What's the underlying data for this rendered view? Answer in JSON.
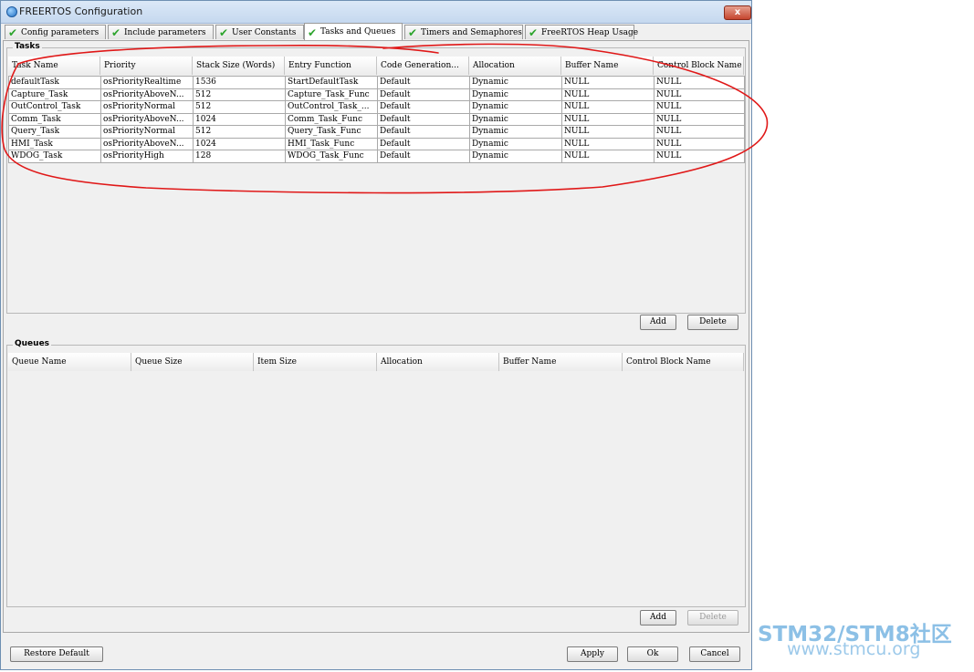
{
  "window": {
    "title": "FREERTOS Configuration",
    "close_label": "x"
  },
  "tabs": [
    {
      "label": "Config parameters",
      "active": false
    },
    {
      "label": "Include parameters",
      "active": false
    },
    {
      "label": "User Constants",
      "active": false
    },
    {
      "label": "Tasks and Queues",
      "active": true
    },
    {
      "label": "Timers and Semaphores",
      "active": false
    },
    {
      "label": "FreeRTOS Heap Usage",
      "active": false
    }
  ],
  "tasks": {
    "title": "Tasks",
    "columns": [
      "Task Name",
      "Priority",
      "Stack Size (Words)",
      "Entry Function",
      "Code Generation...",
      "Allocation",
      "Buffer Name",
      "Control Block Name"
    ],
    "rows": [
      [
        "defaultTask",
        "osPriorityRealtime",
        "1536",
        "StartDefaultTask",
        "Default",
        "Dynamic",
        "NULL",
        "NULL"
      ],
      [
        "Capture_Task",
        "osPriorityAboveN...",
        "512",
        "Capture_Task_Func",
        "Default",
        "Dynamic",
        "NULL",
        "NULL"
      ],
      [
        "OutControl_Task",
        "osPriorityNormal",
        "512",
        "OutControl_Task_...",
        "Default",
        "Dynamic",
        "NULL",
        "NULL"
      ],
      [
        "Comm_Task",
        "osPriorityAboveN...",
        "1024",
        "Comm_Task_Func",
        "Default",
        "Dynamic",
        "NULL",
        "NULL"
      ],
      [
        "Query_Task",
        "osPriorityNormal",
        "512",
        "Query_Task_Func",
        "Default",
        "Dynamic",
        "NULL",
        "NULL"
      ],
      [
        "HMI_Task",
        "osPriorityAboveN...",
        "1024",
        "HMI_Task_Func",
        "Default",
        "Dynamic",
        "NULL",
        "NULL"
      ],
      [
        "WDOG_Task",
        "osPriorityHigh",
        "128",
        "WDOG_Task_Func",
        "Default",
        "Dynamic",
        "NULL",
        "NULL"
      ]
    ],
    "add_label": "Add",
    "delete_label": "Delete"
  },
  "queues": {
    "title": "Queues",
    "columns": [
      "Queue Name",
      "Queue Size",
      "Item Size",
      "Allocation",
      "Buffer Name",
      "Control Block Name"
    ],
    "add_label": "Add",
    "delete_label": "Delete"
  },
  "footer": {
    "restore_label": "Restore Default",
    "apply_label": "Apply",
    "ok_label": "Ok",
    "cancel_label": "Cancel"
  },
  "watermark": {
    "line1": "STM32/STM8社区",
    "line2": "www.stmcu.org"
  },
  "colors": {
    "check": "#2da42d",
    "annotation": "#e01818",
    "watermark": "#8cc0e6"
  }
}
